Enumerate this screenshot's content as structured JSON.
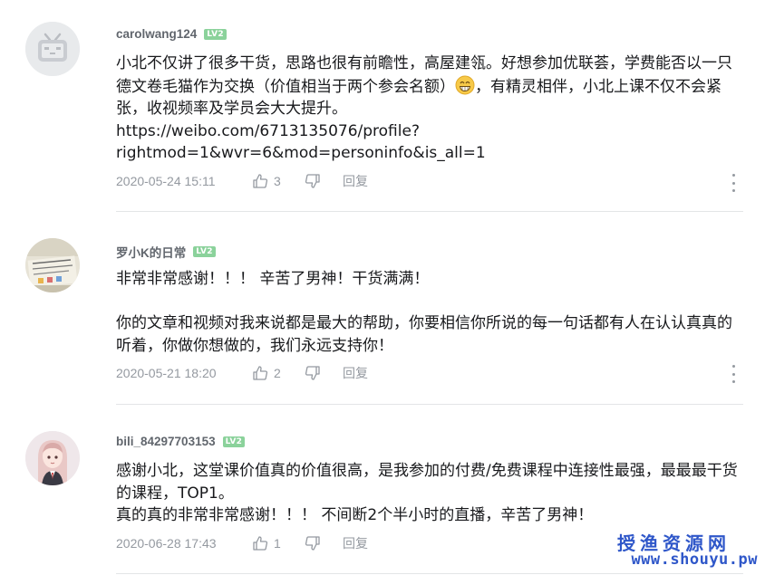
{
  "comments": [
    {
      "username": "carolwang124",
      "level": "LV2",
      "text_before_emoji": "小北不仅讲了很多干货，思路也很有前瞻性，高屋建瓴。好想参加优联荟，学费能否以一只德文卷毛猫作为交换（价值相当于两个参会名额）",
      "emoji": "grinning-emoji",
      "text_after_emoji": "，有精灵相伴，小北上课不仅不会紧张，收视频率及学员会大大提升。\nhttps://weibo.com/6713135076/profile?\nrightmod=1&wvr=6&mod=personinfo&is_all=1",
      "time": "2020-05-24 15:11",
      "likes": "3",
      "reply_label": "回复",
      "avatar": "tv-mascot-avatar"
    },
    {
      "username": "罗小K的日常",
      "level": "LV2",
      "text": "非常非常感谢！！！ 辛苦了男神！干货满满！\n\n你的文章和视频对我来说都是最大的帮助，你要相信你所说的每一句话都有人在认认真真的听着，你做你想做的，我们永远支持你！",
      "time": "2020-05-21 18:20",
      "likes": "2",
      "reply_label": "回复",
      "avatar": "notebook-photo-avatar"
    },
    {
      "username": "bili_84297703153",
      "level": "LV2",
      "text": "感谢小北，这堂课价值真的价值很高，是我参加的付费/免费课程中连接性最强，最最最干货的课程，TOP1。\n真的真的非常非常感谢！！！ 不间断2个半小时的直播，辛苦了男神！",
      "time": "2020-06-28 17:43",
      "likes": "1",
      "reply_label": "回复",
      "avatar": "anime-girl-avatar"
    }
  ],
  "watermark": {
    "line1": "授渔资源网",
    "line2": "www.shouyu.pw"
  },
  "colors": {
    "level_badge": "#8bd29b",
    "meta_text": "#9499a0",
    "watermark": "#2f57c9"
  }
}
